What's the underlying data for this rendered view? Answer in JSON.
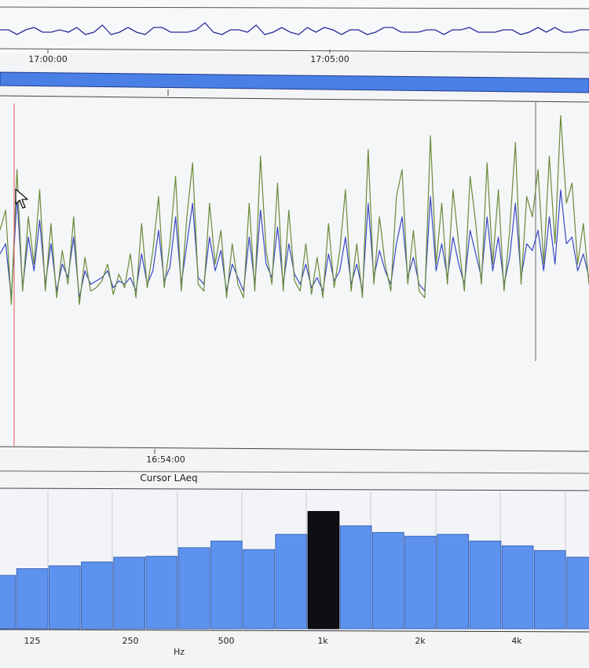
{
  "colors": {
    "background": "#f3f4f6",
    "overview_trace": "#2a2d9a",
    "navigator_bar": "#4a7fe6",
    "series_1": "#3a48c2",
    "series_2": "#6c8a3a",
    "cursor_line": "#e05a5a",
    "spectrum_bar": "#5d93ef",
    "spectrum_highlight": "#0d0f14",
    "grid": "#c9ccd2"
  },
  "chart_data": [
    {
      "type": "line",
      "role": "overview",
      "x_tick_labels": [
        "17:00:00",
        "17:05:00"
      ],
      "series": [
        {
          "values": [
            55,
            56,
            54,
            55,
            57,
            55,
            54,
            56,
            55,
            56,
            54,
            55,
            57,
            54,
            55,
            56,
            55,
            54,
            56,
            57,
            55,
            54,
            55,
            56,
            58,
            55,
            54,
            55,
            56,
            55,
            57,
            54,
            55,
            56,
            55,
            54,
            56,
            55,
            57,
            55,
            54,
            56,
            55,
            54,
            55,
            56,
            57,
            55,
            54,
            55,
            56,
            55,
            54,
            56,
            55,
            57,
            55,
            54,
            55,
            56,
            55,
            54,
            55,
            56,
            55,
            57,
            54,
            55,
            56,
            55
          ]
        }
      ],
      "grid": false
    },
    {
      "type": "line",
      "role": "main",
      "x_tick_labels": [
        "16:54:00"
      ],
      "ylim": [
        0,
        100
      ],
      "series": [
        {
          "values": [
            55,
            58,
            42,
            72,
            45,
            60,
            50,
            65,
            46,
            58,
            44,
            52,
            48,
            60,
            42,
            50,
            46,
            47,
            48,
            50,
            45,
            47,
            46,
            48,
            44,
            55,
            46,
            50,
            62,
            47,
            51,
            66,
            46,
            58,
            70,
            48,
            46,
            60,
            50,
            56,
            44,
            52,
            48,
            44,
            60,
            46,
            68,
            52,
            48,
            63,
            46,
            58,
            49,
            46,
            52,
            45,
            48,
            44,
            55,
            47,
            50,
            60,
            46,
            52,
            44,
            70,
            48,
            56,
            50,
            46,
            58,
            66,
            48,
            54,
            46,
            44,
            72,
            50,
            58,
            48,
            60,
            52,
            46,
            62,
            55,
            48,
            66,
            50,
            60,
            46,
            54,
            70,
            48,
            58,
            56,
            62,
            50,
            66,
            52,
            74,
            58,
            60,
            50,
            55,
            48
          ]
        },
        {
          "values": [
            62,
            68,
            40,
            80,
            44,
            66,
            52,
            74,
            44,
            64,
            42,
            56,
            46,
            66,
            40,
            54,
            44,
            45,
            47,
            52,
            43,
            49,
            45,
            55,
            42,
            64,
            45,
            56,
            72,
            45,
            58,
            78,
            44,
            66,
            82,
            46,
            44,
            70,
            52,
            62,
            42,
            58,
            46,
            42,
            70,
            44,
            84,
            56,
            46,
            76,
            44,
            68,
            47,
            44,
            58,
            43,
            54,
            42,
            64,
            45,
            56,
            74,
            44,
            58,
            42,
            86,
            46,
            66,
            52,
            44,
            72,
            80,
            46,
            62,
            44,
            42,
            90,
            52,
            70,
            46,
            74,
            58,
            44,
            78,
            64,
            46,
            82,
            52,
            74,
            44,
            62,
            88,
            46,
            72,
            66,
            80,
            52,
            84,
            58,
            96,
            70,
            76,
            52,
            64,
            46
          ]
        }
      ],
      "grid": false
    },
    {
      "type": "bar",
      "role": "spectrum",
      "title": "Cursor LAeq",
      "xlabel": "Hz",
      "x_tick_labels": [
        "125",
        "250",
        "500",
        "1k",
        "2k",
        "4k"
      ],
      "values": [
        56,
        63,
        66,
        70,
        75,
        76,
        85,
        92,
        83,
        99,
        123,
        108,
        101,
        97,
        99,
        92,
        87,
        82,
        75
      ],
      "highlight_index": 10,
      "ylim": [
        0,
        140
      ],
      "grid": true
    }
  ]
}
